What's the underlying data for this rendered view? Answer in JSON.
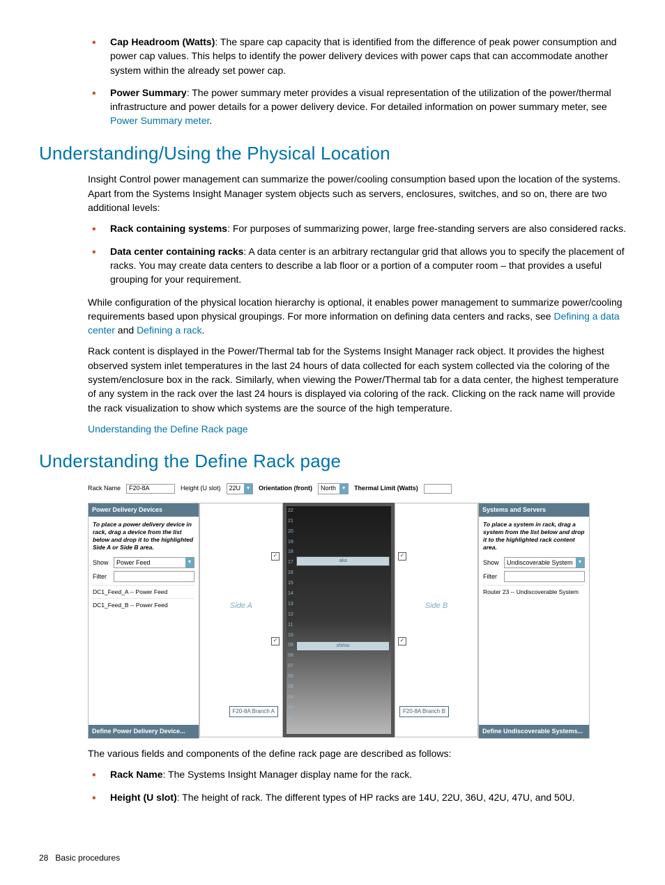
{
  "bullets_top": [
    {
      "term": "Cap Headroom (Watts)",
      "text": ": The spare cap capacity that is identified from the difference of peak power consumption and power cap values. This helps to identify the power delivery devices with power caps that can accommodate another system within the already set power cap."
    },
    {
      "term": "Power Summary",
      "text": ": The power summary meter provides a visual representation of the utilization of the power/thermal infrastructure and power details for a power delivery device. For detailed information on power summary meter, see ",
      "link": "Power Summary meter",
      "suffix": "."
    }
  ],
  "h2_loc": "Understanding/Using the Physical Location",
  "p_loc_intro": "Insight Control power management can summarize the power/cooling consumption based upon the location of the systems. Apart from the Systems Insight Manager system objects such as servers, enclosures, switches, and so on, there are two additional levels:",
  "bullets_loc": [
    {
      "term": "Rack containing systems",
      "text": ": For purposes of summarizing power, large free-standing servers are also considered racks."
    },
    {
      "term": "Data center containing racks",
      "text": ": A data center is an arbitrary rectangular grid that allows you to specify the placement of racks. You may create data centers to describe a lab floor or a portion of a computer room – that provides a useful grouping for your requirement."
    }
  ],
  "p_while_1": "While configuration of the physical location hierarchy is optional, it enables power management to summarize power/cooling requirements based upon physical groupings. For more information on defining data centers and racks, see ",
  "link_dc": "Defining a data center",
  "p_while_and": " and ",
  "link_rack": "Defining a rack",
  "p_while_end": ".",
  "p_rackcontent": "Rack content is displayed in the Power/Thermal tab for the Systems Insight Manager rack object. It provides the highest observed system inlet temperatures in the last 24 hours of data collected for each system collected via the coloring of the system/enclosure box in the rack. Similarly, when viewing the Power/Thermal tab for a data center, the highest temperature of any system in the rack over the last 24 hours is displayed via coloring of the rack. Clicking on the rack name will provide the rack visualization to show which systems are the source of the high temperature.",
  "link_define": "Understanding the Define Rack page",
  "h2_define": "Understanding the Define Rack page",
  "fig": {
    "rack_name_lbl": "Rack Name",
    "rack_name_val": "F20-8A",
    "height_lbl": "Height (U slot)",
    "height_val": "22U",
    "orient_lbl": "Orientation (front)",
    "orient_val": "North",
    "thermal_lbl": "Thermal Limit (Watts)",
    "thermal_val": "",
    "left_header": "Power Delivery Devices",
    "left_hint": "To place a power delivery device in rack, drag a device from the list below and drop it to the highlighted Side A or Side B area.",
    "show_lbl": "Show",
    "show_val_left": "Power Feed",
    "filter_lbl": "Filter",
    "left_items": [
      "DC1_Feed_A -- Power Feed",
      "DC1_Feed_B -- Power Feed"
    ],
    "left_footer": "Define Power Delivery Device...",
    "side_a": "Side A",
    "side_b": "Side B",
    "branch_a": "F20-8A Branch A",
    "branch_b": "F20-8A Branch B",
    "rack_item1": "aka",
    "rack_item2": "shirou",
    "slots": [
      "22",
      "21",
      "20",
      "19",
      "18",
      "17",
      "16",
      "15",
      "14",
      "13",
      "12",
      "11",
      "10",
      "09",
      "08",
      "07",
      "06",
      "05",
      "04",
      "03",
      "02",
      "01"
    ],
    "right_header": "Systems and Servers",
    "right_hint": "To place a system in rack, drag a system from the list below and drop it to the highlighted rack content area.",
    "show_val_right": "Undiscoverable System",
    "right_items": [
      "Router 23 -- Undiscoverable System"
    ],
    "right_footer": "Define Undiscoverable Systems..."
  },
  "p_various": "The various fields and components of the define rack page are described as follows:",
  "bullets_define": [
    {
      "term": "Rack Name",
      "text": ": The Systems Insight Manager display name for the rack."
    },
    {
      "term": "Height (U slot)",
      "text": ": The height of rack. The different types of HP racks are 14U, 22U, 36U, 42U, 47U, and 50U."
    }
  ],
  "page_num": "28",
  "page_section": "Basic procedures"
}
